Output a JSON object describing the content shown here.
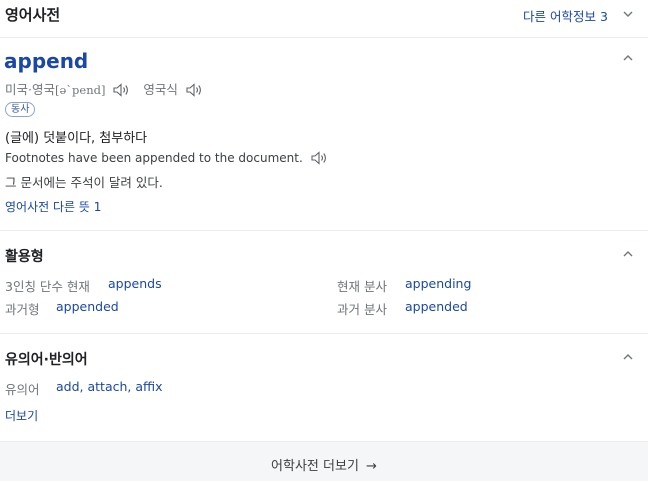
{
  "header": {
    "title": "영어사전",
    "other_link": "다른 어학정보",
    "other_count": "3"
  },
  "entry": {
    "word": "append",
    "pron_us_uk": "미국·영국",
    "phonetic": "[ə`pend]",
    "pron_uk_only": "영국식",
    "pos": "동사",
    "meaning": "(글에) 덧붙이다, 첨부하다",
    "example_en": "Footnotes have been appended to the document.",
    "example_ko": "그 문서에는 주석이 달려 있다.",
    "more_meanings": "영어사전 다른 뜻 1"
  },
  "conjugation": {
    "title": "활용형",
    "third_person_label": "3인칭 단수 현재",
    "third_person_value": "appends",
    "present_participle_label": "현재 분사",
    "present_participle_value": "appending",
    "past_label": "과거형",
    "past_value": "appended",
    "past_participle_label": "과거 분사",
    "past_participle_value": "appended"
  },
  "synonyms": {
    "title": "유의어·반의어",
    "synonym_label": "유의어",
    "synonym_values": "add, attach, affix",
    "more": "더보기"
  },
  "footer": {
    "link": "어학사전 더보기",
    "arrow": "→"
  },
  "colors": {
    "accent": "#1a47a8",
    "text": "#202124",
    "muted": "#70757a",
    "footer_bg": "#f5f6f7"
  }
}
